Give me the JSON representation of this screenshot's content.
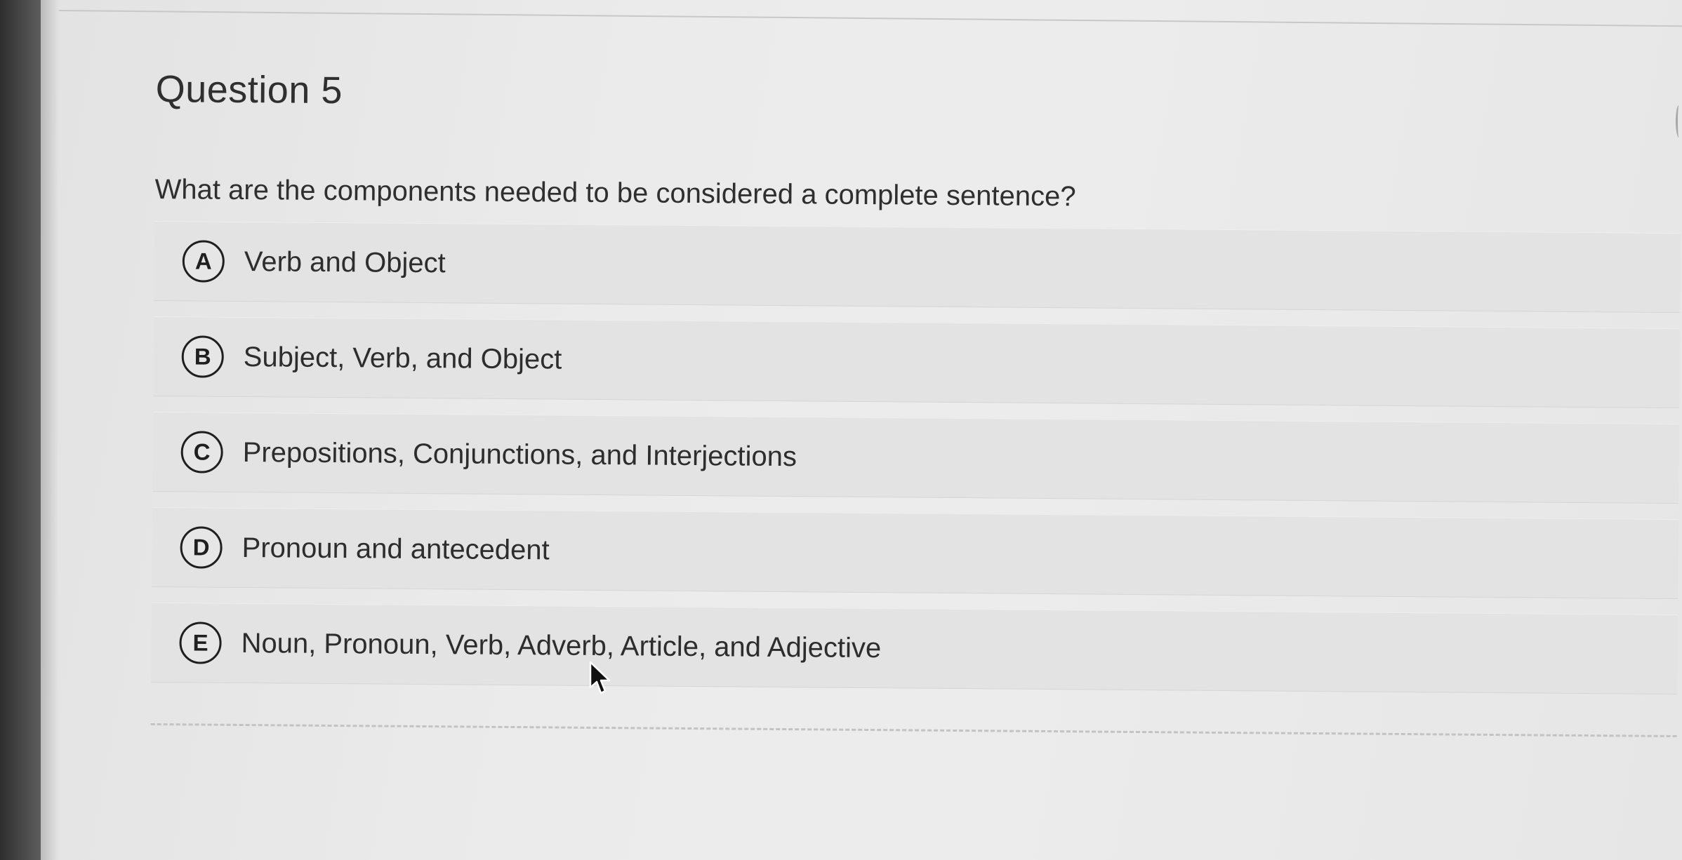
{
  "question": {
    "title": "Question 5",
    "text": "What are the components needed to be considered a complete sentence?"
  },
  "options": [
    {
      "letter": "A",
      "text": "Verb and Object"
    },
    {
      "letter": "B",
      "text": "Subject, Verb, and Object"
    },
    {
      "letter": "C",
      "text": "Prepositions, Conjunctions, and Interjections"
    },
    {
      "letter": "D",
      "text": "Pronoun and antecedent"
    },
    {
      "letter": "E",
      "text": "Noun, Pronoun, Verb, Adverb, Article, and Adjective"
    }
  ],
  "cursor": {
    "icon": "arrow-cursor-icon"
  }
}
